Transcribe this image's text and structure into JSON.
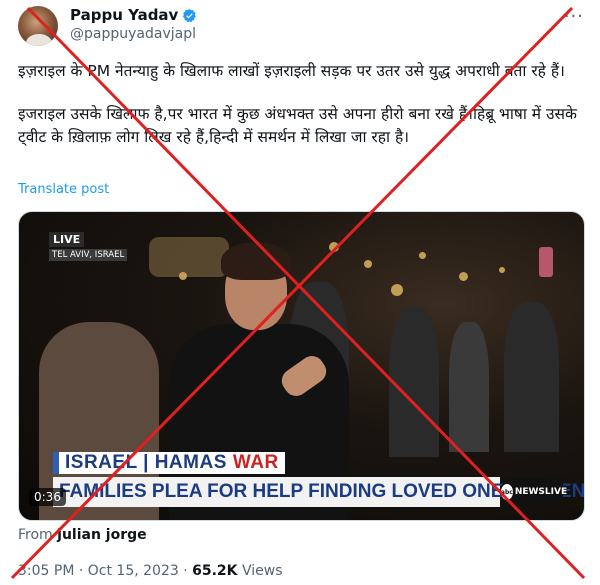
{
  "author": {
    "display_name": "Pappu Yadav",
    "handle": "@pappuyadavjapl"
  },
  "tweet": {
    "paragraph1": "इज़राइल के PM नेतन्याहु के खिलाफ लाखों इज़राइली सड़क पर उतर उसे युद्ध अपराधी बता रहे हैं।",
    "paragraph2": "इजराइल उसके खिलाफ है,पर भारत में कुछ अंधभक्त उसे अपना हीरो बना रखे हैं।हिब्रू भाषा में उसके ट्वीट के ख़िलाफ़ लोग लिख रहे हैं,हिन्दी में समर्थन में लिखा जा रहा है।",
    "translate_label": "Translate post"
  },
  "video": {
    "live_label": "LIVE",
    "location": "TEL AVIV, ISRAEL",
    "banner_left": "ISRAEL | HAMAS",
    "banner_right": "WAR",
    "headline": "FAMILIES PLEA FOR HELP FINDING LOVED ONES TAKEN HOSTAGE",
    "logo_abc": "abc",
    "logo_news": "NEWSLIVE",
    "duration": "0:36"
  },
  "attribution": {
    "prefix": "From",
    "source": "julian jorge"
  },
  "meta": {
    "timestamp": "3:05 PM · Oct 15, 2023 ·",
    "views_count": "65.2K",
    "views_label": "Views"
  },
  "colors": {
    "link": "#1d9bf0",
    "verified": "#1d9bf0",
    "overlay_x": "#e02020"
  }
}
